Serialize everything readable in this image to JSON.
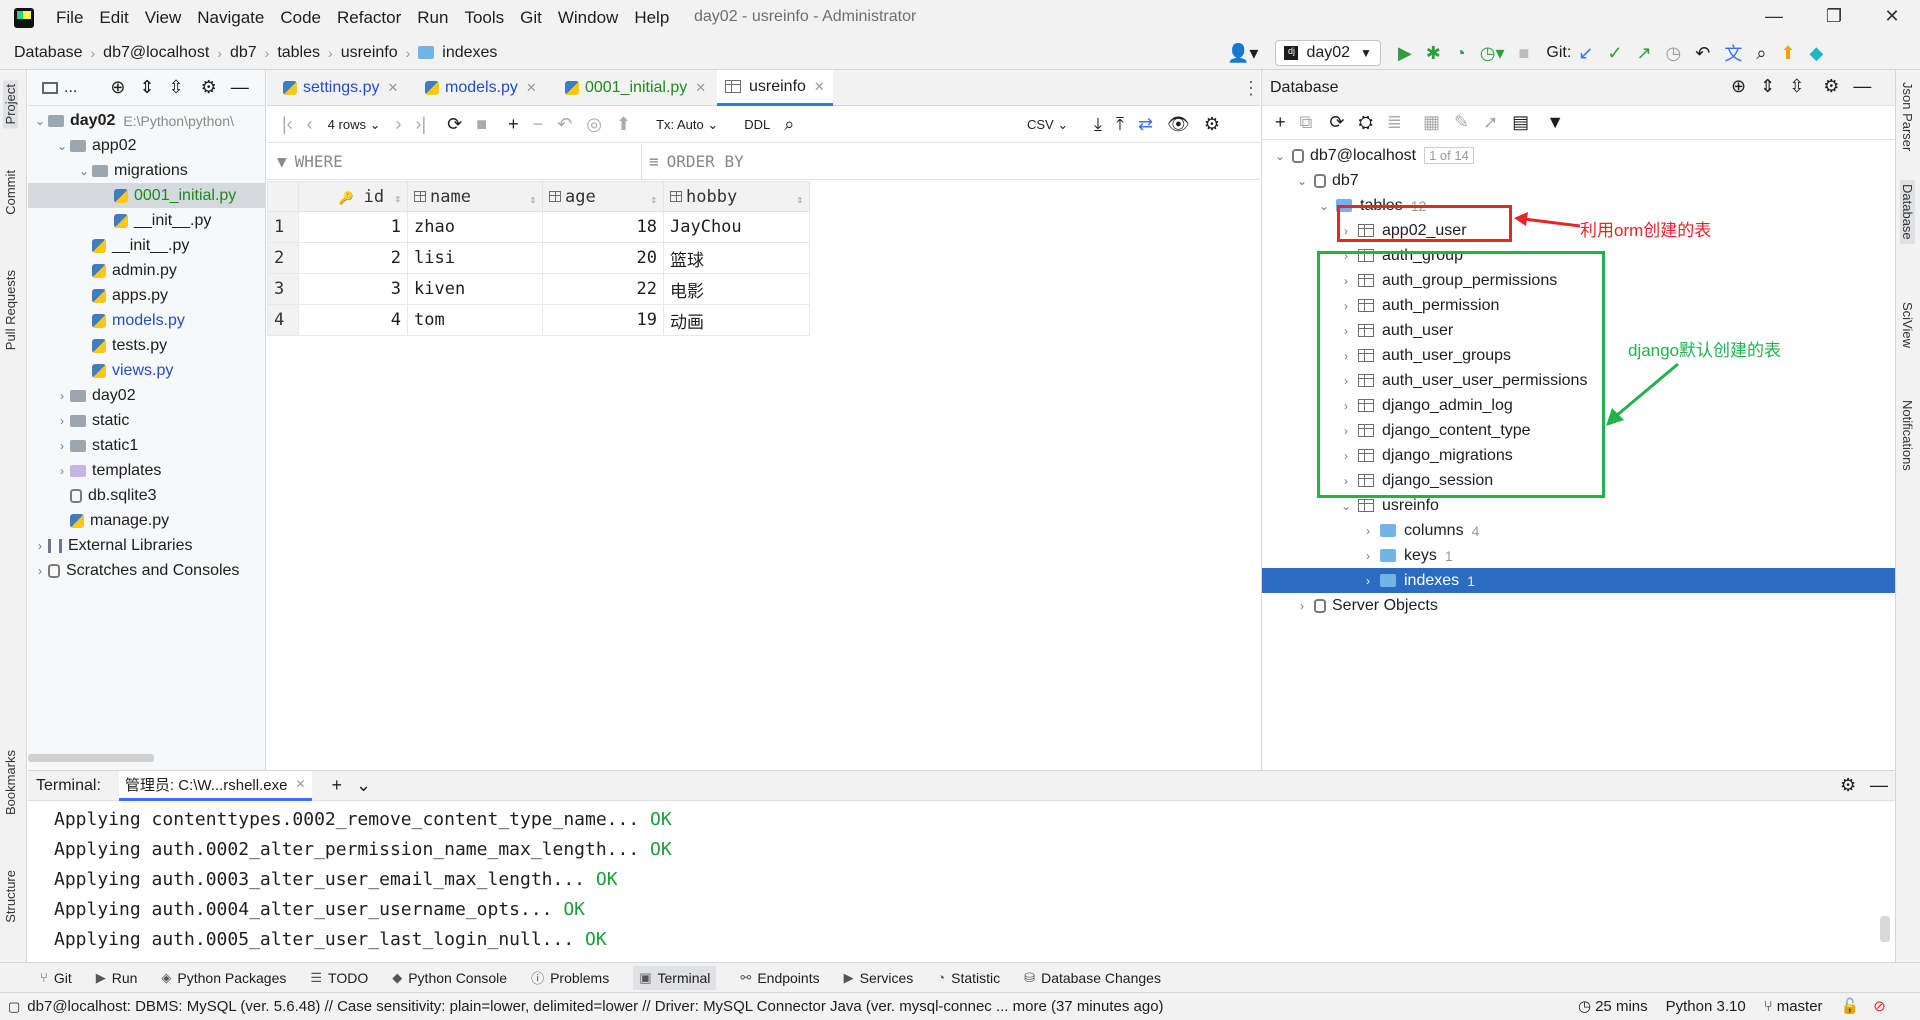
{
  "menu": [
    "File",
    "Edit",
    "View",
    "Navigate",
    "Code",
    "Refactor",
    "Run",
    "Tools",
    "Git",
    "Window",
    "Help"
  ],
  "window_title": "day02 - usreinfo - Administrator",
  "breadcrumb": [
    "Database",
    "db7@localhost",
    "db7",
    "tables",
    "usreinfo",
    "indexes"
  ],
  "run_config": "day02",
  "git_label": "Git:",
  "project_tree": [
    {
      "label": "day02",
      "path": "E:\\Python\\python\\",
      "type": "root",
      "bold": true
    },
    {
      "label": "app02",
      "type": "folder"
    },
    {
      "label": "migrations",
      "type": "folder"
    },
    {
      "label": "0001_initial.py",
      "type": "py",
      "color": "#1e8a1e"
    },
    {
      "label": "__init__.py",
      "type": "py"
    },
    {
      "label": "__init__.py",
      "type": "py"
    },
    {
      "label": "admin.py",
      "type": "py"
    },
    {
      "label": "apps.py",
      "type": "py"
    },
    {
      "label": "models.py",
      "type": "py",
      "color": "#1f4ec4"
    },
    {
      "label": "tests.py",
      "type": "py"
    },
    {
      "label": "views.py",
      "type": "py",
      "color": "#1f4ec4"
    },
    {
      "label": "day02",
      "type": "folder"
    },
    {
      "label": "static",
      "type": "folder"
    },
    {
      "label": "static1",
      "type": "folder"
    },
    {
      "label": "templates",
      "type": "folder-purple"
    },
    {
      "label": "db.sqlite3",
      "type": "db"
    },
    {
      "label": "manage.py",
      "type": "py"
    },
    {
      "label": "External Libraries",
      "type": "lib"
    },
    {
      "label": "Scratches and Consoles",
      "type": "scratch"
    }
  ],
  "editor_tabs": [
    {
      "label": "settings.py",
      "color": "#1f4ec4"
    },
    {
      "label": "models.py",
      "color": "#1f4ec4"
    },
    {
      "label": "0001_initial.py",
      "color": "#1e8a1e"
    },
    {
      "label": "usreinfo",
      "color": "#1e1e1e",
      "active": true
    }
  ],
  "grid_toolbar": {
    "rows": "4 rows",
    "tx": "Tx: Auto",
    "ddl": "DDL",
    "csv": "CSV"
  },
  "filter": {
    "where": "WHERE",
    "order_by": "ORDER BY"
  },
  "grid": {
    "columns": [
      "id",
      "name",
      "age",
      "hobby"
    ],
    "rows": [
      {
        "n": "1",
        "id": "1",
        "name": "zhao",
        "age": "18",
        "hobby": "JayChou"
      },
      {
        "n": "2",
        "id": "2",
        "name": "lisi",
        "age": "20",
        "hobby": "篮球"
      },
      {
        "n": "3",
        "id": "3",
        "name": "kiven",
        "age": "22",
        "hobby": "电影"
      },
      {
        "n": "4",
        "id": "4",
        "name": "tom",
        "age": "19",
        "hobby": "动画"
      }
    ]
  },
  "db_panel": {
    "title": "Database",
    "host": "db7@localhost",
    "host_count": "1 of 14",
    "schema": "db7",
    "tables_label": "tables",
    "tables_count": "12",
    "tables": [
      "app02_user",
      "auth_group",
      "auth_group_permissions",
      "auth_permission",
      "auth_user",
      "auth_user_groups",
      "auth_user_user_permissions",
      "django_admin_log",
      "django_content_type",
      "django_migrations",
      "django_session",
      "usreinfo"
    ],
    "usreinfo_children": [
      {
        "label": "columns",
        "count": "4"
      },
      {
        "label": "keys",
        "count": "1"
      },
      {
        "label": "indexes",
        "count": "1"
      }
    ],
    "server_objects": "Server Objects",
    "annotation_red": "利用orm创建的表",
    "annotation_green": "django默认创建的表",
    "red_color": "#e8252a",
    "green_color": "#22b14c"
  },
  "terminal": {
    "label": "Terminal:",
    "tab": "管理员: C:\\W...rshell.exe",
    "lines": [
      {
        "text": "Applying contenttypes.0002_remove_content_type_name... ",
        "ok": "OK"
      },
      {
        "text": "Applying auth.0002_alter_permission_name_max_length... ",
        "ok": "OK"
      },
      {
        "text": "Applying auth.0003_alter_user_email_max_length... ",
        "ok": "OK"
      },
      {
        "text": "Applying auth.0004_alter_user_username_opts... ",
        "ok": "OK"
      },
      {
        "text": "Applying auth.0005_alter_user_last_login_null... ",
        "ok": "OK"
      }
    ]
  },
  "bottom_tools": [
    "Git",
    "Run",
    "Python Packages",
    "TODO",
    "Python Console",
    "Problems",
    "Terminal",
    "Endpoints",
    "Services",
    "Statistic",
    "Database Changes"
  ],
  "left_tabs": [
    "Project",
    "Commit",
    "Pull Requests",
    "Bookmarks",
    "Structure"
  ],
  "right_tabs": [
    "Json Parser",
    "Database",
    "SciView",
    "Notifications"
  ],
  "status": {
    "text": "db7@localhost: DBMS: MySQL (ver. 5.6.48) // Case sensitivity: plain=lower, delimited=lower // Driver: MySQL Connector Java (ver. mysql-connec ... more (37 minutes ago)",
    "time": "25 mins",
    "python": "Python 3.10",
    "branch": "master"
  }
}
